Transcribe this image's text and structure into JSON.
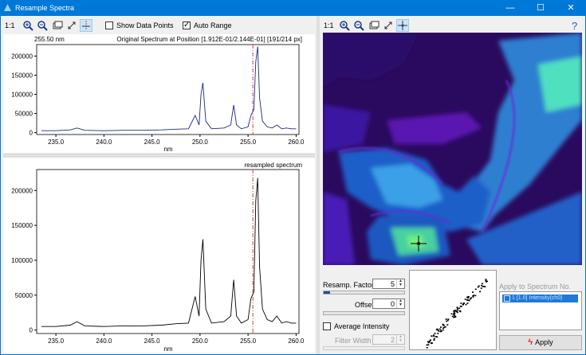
{
  "window": {
    "title": "Resample Spectra",
    "minimize_glyph": "—",
    "maximize_glyph": "☐",
    "close_glyph": "✕"
  },
  "left_toolbar": {
    "scale_label": "1:1",
    "show_data_points_label": "Show Data Points",
    "show_data_points_checked": false,
    "auto_range_label": "Auto Range",
    "auto_range_checked": true
  },
  "right_toolbar": {
    "scale_label": "1:1",
    "help_glyph": "?"
  },
  "top_plot": {
    "position_readout": "255.50 nm",
    "title": "Original Spectrum at Position [1.912E-01/2.144E-01] [191/214 px]",
    "xlabel": "nm",
    "xticks": [
      "235.0",
      "240.0",
      "245.0",
      "250.0",
      "255.0",
      "260.0"
    ],
    "yticks": [
      "0",
      "50000",
      "100000",
      "150000",
      "200000"
    ],
    "line_color": "#1a2a7a"
  },
  "bottom_plot": {
    "title": "resampled spectrum",
    "xlabel": "nm",
    "xticks": [
      "235.0",
      "240.0",
      "245.0",
      "250.0",
      "255.0",
      "260.0"
    ],
    "yticks": [
      "0",
      "50000",
      "100000",
      "150000",
      "200000"
    ],
    "line_color": "#000000"
  },
  "chart_data": [
    {
      "type": "line",
      "title": "Original Spectrum at Position [1.912E-01/2.144E-01] [191/214 px]",
      "xlabel": "nm",
      "ylabel": "",
      "xlim": [
        233,
        260.3
      ],
      "ylim": [
        -5000,
        230000
      ],
      "marker_x": 255.5,
      "series": [
        {
          "x": [
            233.5,
            235,
            236.5,
            237.2,
            238,
            240,
            242,
            244,
            246,
            247.5,
            248.8,
            249.5,
            249.9,
            250.1,
            250.3,
            250.6,
            251.2,
            252.5,
            253.2,
            253.5,
            253.8,
            254.3,
            255,
            255.3,
            255.6,
            255.8,
            256.0,
            256.2,
            256.5,
            257,
            257.5,
            258,
            258.5,
            259,
            259.5,
            260
          ],
          "y": [
            5000,
            5000,
            7000,
            12000,
            6000,
            5000,
            6000,
            6000,
            7000,
            9000,
            10000,
            45000,
            20000,
            100000,
            130000,
            30000,
            10000,
            12000,
            20000,
            72000,
            20000,
            10000,
            15000,
            45000,
            60000,
            185000,
            225000,
            90000,
            30000,
            15000,
            12000,
            20000,
            10000,
            12000,
            10000,
            10000
          ]
        }
      ]
    },
    {
      "type": "line",
      "title": "resampled spectrum",
      "xlabel": "nm",
      "ylabel": "",
      "xlim": [
        233,
        260.3
      ],
      "ylim": [
        -5000,
        230000
      ],
      "marker_x": 255.5,
      "series": [
        {
          "x": [
            233.5,
            235,
            236.5,
            237.2,
            238,
            240,
            242,
            244,
            246,
            247.5,
            248.8,
            249.5,
            249.9,
            250.1,
            250.3,
            250.6,
            251.2,
            252.5,
            253.2,
            253.5,
            253.8,
            254.3,
            255,
            255.3,
            255.6,
            255.8,
            256.0,
            256.2,
            256.5,
            257,
            257.5,
            258,
            258.5,
            259,
            259.5,
            260
          ],
          "y": [
            5000,
            5000,
            7000,
            12000,
            6000,
            5000,
            6000,
            6000,
            7000,
            9000,
            10000,
            48000,
            20000,
            100000,
            130000,
            30000,
            10000,
            12000,
            20000,
            72000,
            20000,
            10000,
            15000,
            45000,
            55000,
            185000,
            218000,
            90000,
            30000,
            15000,
            12000,
            20000,
            10000,
            12000,
            10000,
            10000
          ]
        }
      ]
    }
  ],
  "controls": {
    "resamp_factor_label": "Resamp. Factor",
    "resamp_factor_value": "5",
    "resamp_slider_level": 0.08,
    "offset_label": "Offset",
    "offset_value": "0",
    "offset_slider_level": 0.0,
    "average_intensity_label": "Average Intensity",
    "average_intensity_checked": false,
    "filter_width_label": "Filter Width",
    "filter_width_value": "2",
    "apply_to_label": "Apply to Spectrum No.",
    "apply_list_item": "1 [1.0]  Intensity(ch0)",
    "apply_button_label": "Apply"
  },
  "colors": {
    "accent": "#0078d7",
    "marker": "#d04040",
    "selection": "#1e7ad6"
  }
}
